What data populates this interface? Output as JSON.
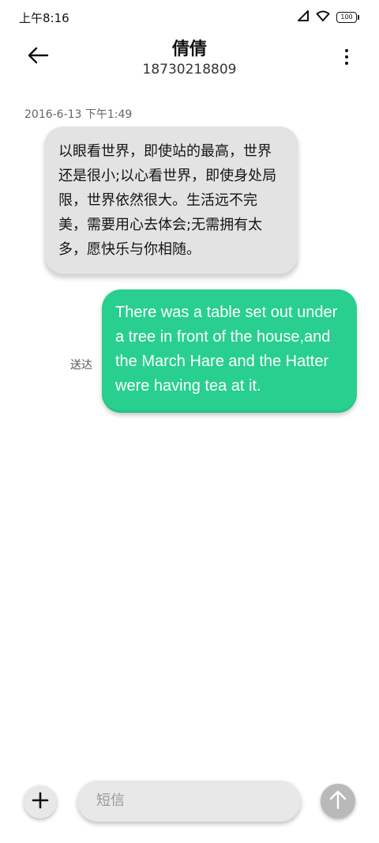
{
  "status_bar": {
    "time": "上午8:16",
    "battery": "100",
    "icons": [
      "signal-icon",
      "wifi-icon",
      "battery-icon"
    ]
  },
  "header": {
    "contact_name": "倩倩",
    "phone_number": "18730218809",
    "icons": [
      "back-arrow-icon",
      "more-vertical-icon"
    ]
  },
  "conversation": {
    "timestamp": "2016-6-13 下午1:49",
    "incoming_message": "以眼看世界，即使站的最高，世界还是很小;以心看世界，即使身处局限，世界依然很大。生活远不完美，需要用心去体会;无需拥有太多，愿快乐与你相随。",
    "outgoing_message": "There was a table set out under a tree in front of the house,and the March Hare and the Hatter were having tea at it.",
    "delivery_status": "送达"
  },
  "compose": {
    "placeholder": "短信",
    "icons": [
      "plus-icon",
      "send-arrow-up-icon"
    ]
  },
  "colors": {
    "incoming_bubble": "#e3e3e3",
    "outgoing_bubble": "#28cf8f",
    "send_button": "#b9b9b9",
    "background": "#ffffff"
  }
}
